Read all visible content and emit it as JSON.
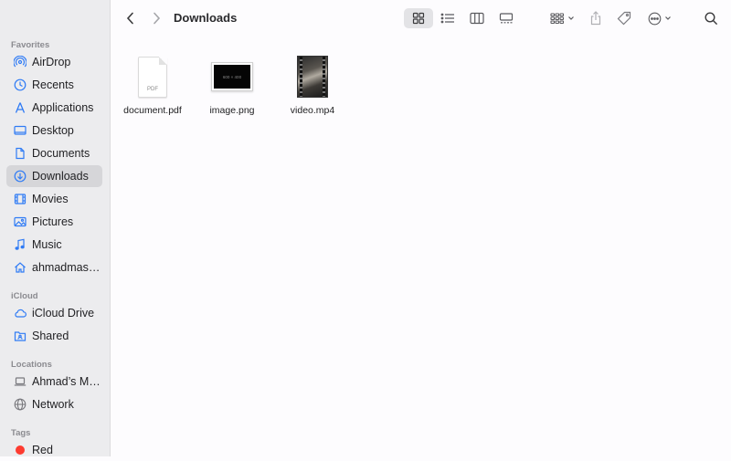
{
  "window": {
    "title": "Downloads"
  },
  "sidebar": {
    "favorites_title": "Favorites",
    "favorites": [
      {
        "label": "AirDrop",
        "icon": "airdrop-icon"
      },
      {
        "label": "Recents",
        "icon": "clock-icon"
      },
      {
        "label": "Applications",
        "icon": "applications-icon"
      },
      {
        "label": "Desktop",
        "icon": "desktop-icon"
      },
      {
        "label": "Documents",
        "icon": "document-icon"
      },
      {
        "label": "Downloads",
        "icon": "download-icon",
        "selected": true
      },
      {
        "label": "Movies",
        "icon": "film-icon"
      },
      {
        "label": "Pictures",
        "icon": "photo-icon"
      },
      {
        "label": "Music",
        "icon": "music-note-icon"
      },
      {
        "label": "ahmadmas…",
        "icon": "home-icon"
      }
    ],
    "icloud_title": "iCloud",
    "icloud": [
      {
        "label": "iCloud Drive",
        "icon": "cloud-icon"
      },
      {
        "label": "Shared",
        "icon": "shared-folder-icon"
      }
    ],
    "locations_title": "Locations",
    "locations": [
      {
        "label": "Ahmad’s M…",
        "icon": "laptop-icon"
      },
      {
        "label": "Network",
        "icon": "globe-icon"
      }
    ],
    "tags_title": "Tags",
    "tags": [
      {
        "label": "Red",
        "color": "#fd3b30"
      }
    ]
  },
  "files": [
    {
      "name": "document.pdf",
      "kind": "pdf",
      "badge": "PDF"
    },
    {
      "name": "image.png",
      "kind": "image",
      "thumb_text": "600 × 400"
    },
    {
      "name": "video.mp4",
      "kind": "video"
    }
  ],
  "colors": {
    "accent": "#2f7bf5",
    "sidebar_bg": "#ececee",
    "selected_bg": "#d6d6d9"
  }
}
